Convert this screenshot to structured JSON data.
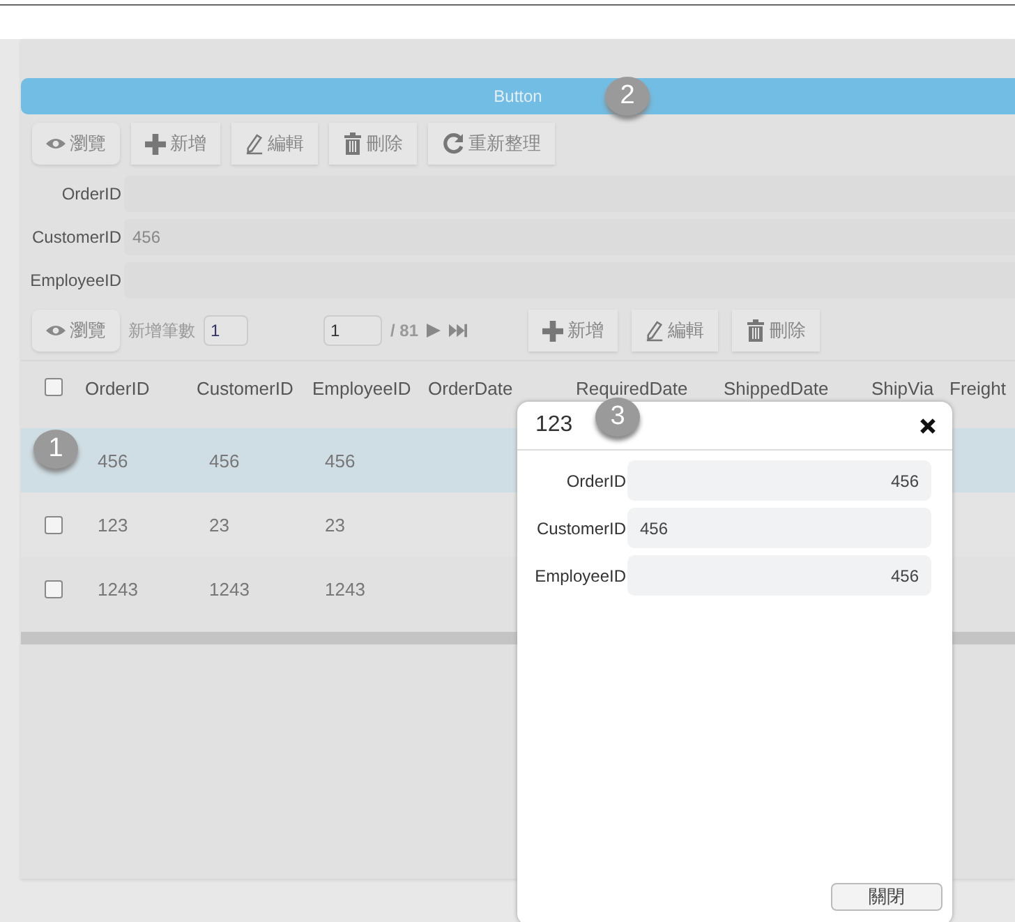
{
  "top_button": {
    "label": "Button"
  },
  "toolbar": [
    {
      "label": "瀏覽"
    },
    {
      "label": "新增"
    },
    {
      "label": "編輯"
    },
    {
      "label": "刪除"
    },
    {
      "label": "重新整理"
    }
  ],
  "form": [
    {
      "label": "OrderID"
    },
    {
      "label": "CustomerID",
      "value": "456"
    },
    {
      "label": "EmployeeID"
    }
  ],
  "pager": {
    "view_button": {
      "label": "瀏覽"
    },
    "add_count_label": "新增筆數",
    "add_count": "1",
    "page": "1",
    "total": "/ 81",
    "buttons": [
      {
        "label": "新增"
      },
      {
        "label": "編輯"
      },
      {
        "label": "刪除"
      }
    ]
  },
  "table": {
    "select_all": {
      "checked": false
    },
    "columns": [
      "OrderID",
      "CustomerID",
      "EmployeeID",
      "OrderDate",
      "RequiredDate",
      "ShippedDate",
      "ShipVia",
      "Freight"
    ],
    "rows": [
      {
        "selected": true,
        "cells": [
          "456",
          "456",
          "456"
        ]
      },
      {
        "selected": false,
        "checked": false,
        "cells": [
          "123",
          "23",
          "23"
        ]
      },
      {
        "selected": false,
        "checked": false,
        "cells": [
          "1243",
          "1243",
          "1243"
        ]
      }
    ]
  },
  "dialog": {
    "title": "123",
    "fields": [
      {
        "label": "OrderID",
        "value": "456"
      },
      {
        "label": "CustomerID",
        "value": "456"
      },
      {
        "label": "EmployeeID",
        "value": "456"
      }
    ],
    "close_button": "關閉"
  },
  "badges": [
    {
      "label": "1"
    },
    {
      "label": "2"
    },
    {
      "label": "3"
    }
  ]
}
